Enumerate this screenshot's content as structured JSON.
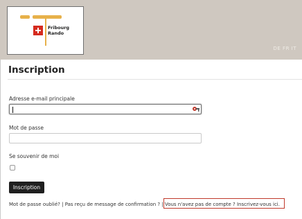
{
  "logo": {
    "line1": "Fribourg",
    "line2": "Rando"
  },
  "header": {
    "language": "DE FR IT"
  },
  "form": {
    "title": "Inscription",
    "email_label": "Adresse e-mail principale",
    "email_value": "",
    "password_label": "Mot de passe",
    "password_value": "",
    "remember_label": "Se souvenir de moi",
    "remember_checked": false,
    "submit_label": "Inscription"
  },
  "links": {
    "forgot": "Mot de passe oublié?",
    "sep1": " | ",
    "resend": "Pas reçu de message de confirmation ?",
    "sep2": " | ",
    "register": "Vous n'avez pas de compte ? Inscrivez-vous ici."
  },
  "icons": {
    "password_manager": "password-manager-icon"
  },
  "colors": {
    "header_bg": "#cfc8c0",
    "button_bg": "#1f1f1f",
    "highlight": "#c0392b",
    "logo_accent": "#e7b14a",
    "logo_cross": "#d52b1e"
  }
}
